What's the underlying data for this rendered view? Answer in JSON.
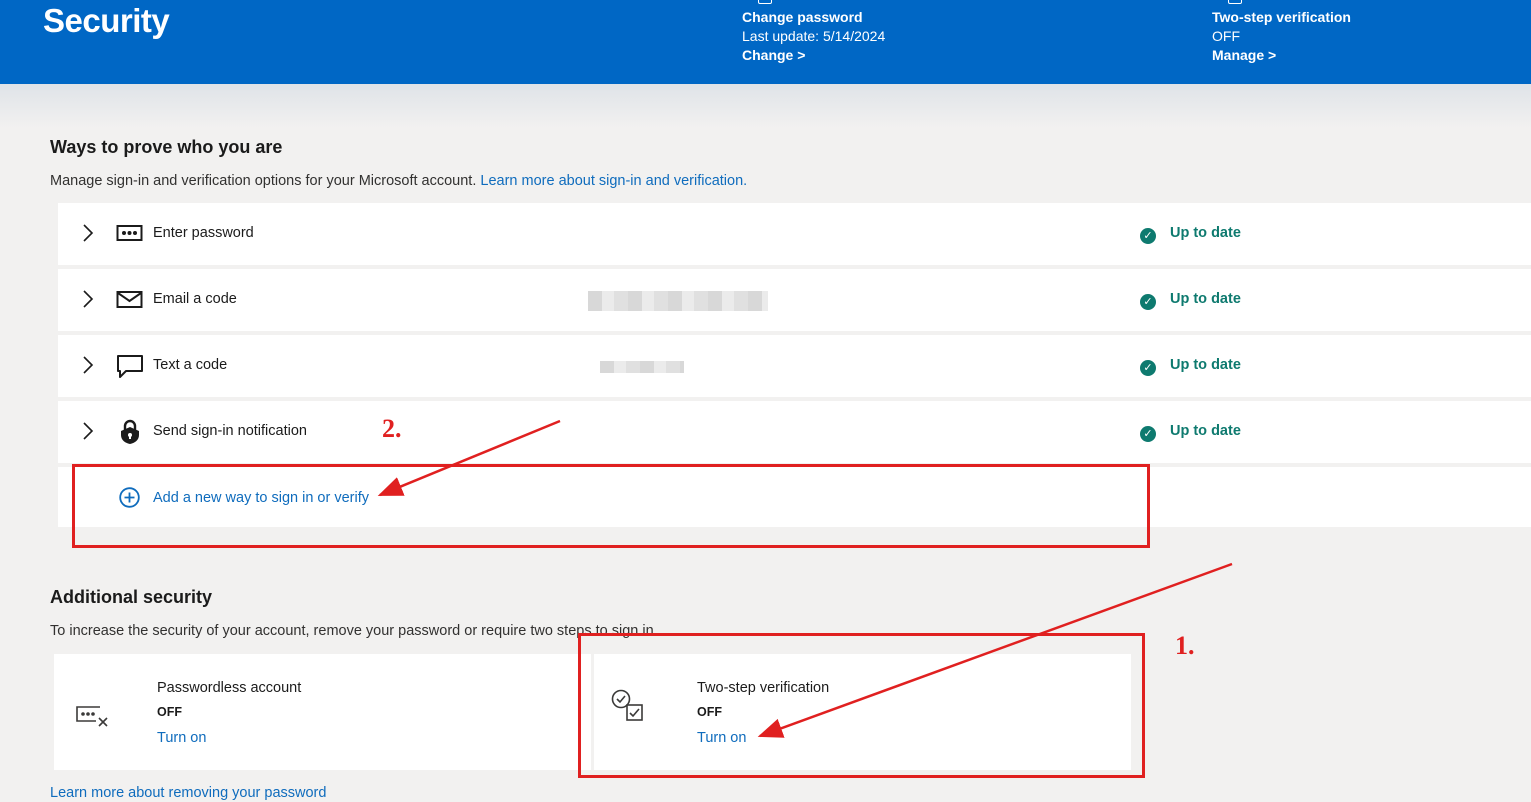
{
  "header": {
    "title": "Security",
    "cards": [
      {
        "title": "Change password",
        "subtitle": "Last update: 5/14/2024",
        "link": "Change >"
      },
      {
        "title": "Two-step verification",
        "subtitle": "OFF",
        "link": "Manage >"
      }
    ],
    "background_color": "#0067c5"
  },
  "ways": {
    "title": "Ways to prove who you are",
    "description": "Manage sign-in and verification options for your Microsoft account.",
    "learn_more": "Learn more about sign-in and verification.",
    "methods": [
      {
        "label": "Enter password",
        "icon": "password-dots-icon",
        "status": "Up to date"
      },
      {
        "label": "Email a code",
        "icon": "envelope-icon",
        "status": "Up to date"
      },
      {
        "label": "Text a code",
        "icon": "chat-bubble-icon",
        "status": "Up to date"
      },
      {
        "label": "Send sign-in notification",
        "icon": "lock-icon",
        "status": "Up to date"
      }
    ],
    "add_label": "Add a new way to sign in or verify"
  },
  "additional": {
    "title": "Additional security",
    "description": "To increase the security of your account, remove your password or require two steps to sign in.",
    "cards": [
      {
        "title": "Passwordless account",
        "status": "OFF",
        "link": "Turn on",
        "icon": "passwordless-icon"
      },
      {
        "title": "Two-step verification",
        "status": "OFF",
        "link": "Turn on",
        "icon": "two-step-icon"
      }
    ],
    "learn_more": "Learn more about removing your password"
  },
  "annotations": {
    "step1": "1.",
    "step2": "2.",
    "color": "#e02020"
  },
  "status_color": "#0e7a6f",
  "link_color": "#0f6cbd"
}
